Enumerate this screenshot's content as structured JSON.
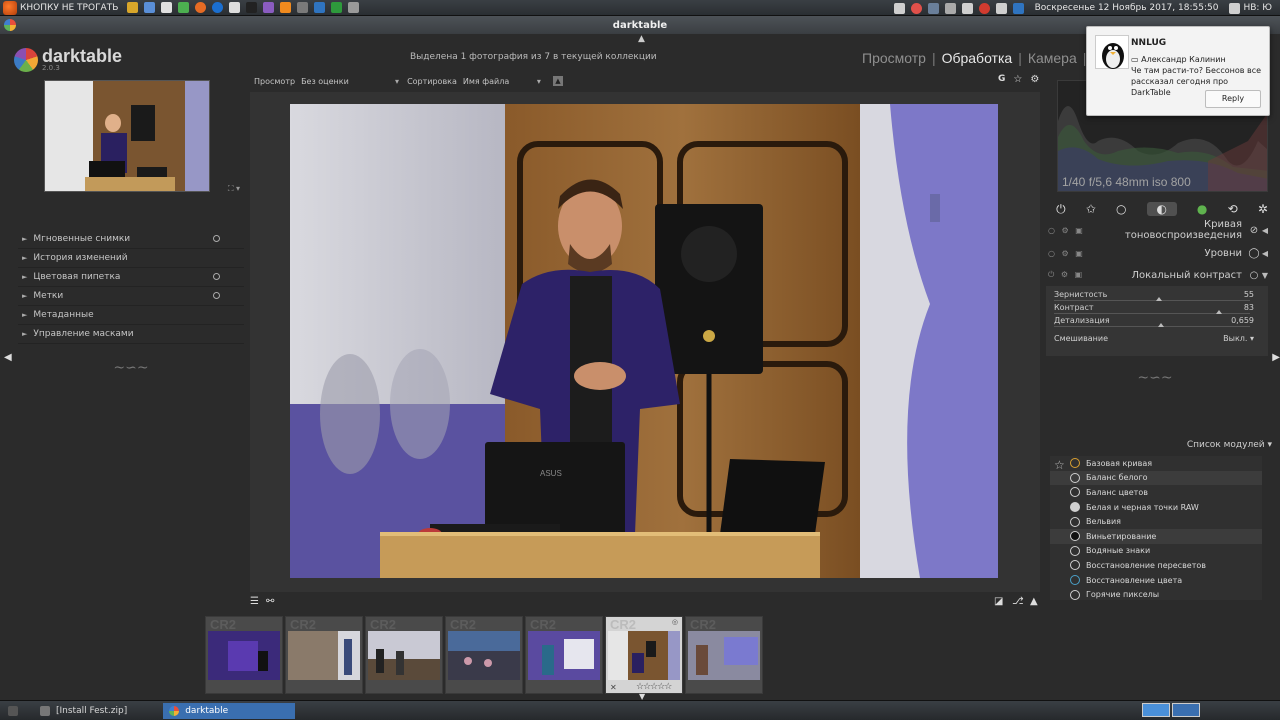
{
  "system_bar": {
    "launcher_label": "КНОПКУ НЕ ТРОГАТЬ",
    "datetime": "Воскресенье 12 Ноябрь 2017, 18:55:50",
    "keyboard_layout": "НВ: Ю"
  },
  "window": {
    "title": "darktable"
  },
  "app": {
    "name": "darktable",
    "version": "2.0.3",
    "selection_status": "Выделена 1 фотография из 7 в текущей коллекции",
    "views": [
      "Просмотр",
      "Обработка",
      "Камера"
    ],
    "active_view": "Обработка"
  },
  "left_panel": {
    "modules": [
      {
        "label": "Мгновенные снимки",
        "has_preset": true
      },
      {
        "label": "История изменений",
        "has_preset": false
      },
      {
        "label": "Цветовая пипетка",
        "has_preset": true
      },
      {
        "label": "Метки",
        "has_preset": true
      },
      {
        "label": "Метаданные",
        "has_preset": false
      },
      {
        "label": "Управление масками",
        "has_preset": false
      }
    ]
  },
  "center_toolbar": {
    "view_label": "Просмотр",
    "view_value": "Без оценки",
    "sort_label": "Сортировка",
    "sort_value": "Имя файла",
    "group_button": "G"
  },
  "right_panel": {
    "exif": "1/40 f/5,6 48mm iso 800",
    "modules": [
      {
        "label": "Кривая тоновоспроизведения",
        "icon": "tonecurve-icon",
        "expanded": false
      },
      {
        "label": "Уровни",
        "icon": "levels-icon",
        "expanded": false
      },
      {
        "label": "Локальный контраст",
        "icon": "local-contrast-icon",
        "expanded": true
      }
    ],
    "local_contrast": {
      "sliders": [
        {
          "label": "Зернистость",
          "value": "55"
        },
        {
          "label": "Контраст",
          "value": "83"
        },
        {
          "label": "Детализация",
          "value": "0,659"
        }
      ],
      "blend_label": "Смешивание",
      "blend_value": "Выкл."
    },
    "module_list_title": "Список модулей",
    "module_list": [
      "Базовая кривая",
      "Баланс белого",
      "Баланс цветов",
      "Белая и черная точки RAW",
      "Вельвия",
      "Виньетирование",
      "Водяные знаки",
      "Восстановление пересветов",
      "Восстановление цвета",
      "Горячие пикселы"
    ]
  },
  "filmstrip": {
    "ext_label": "CR2",
    "thumbs": 7,
    "selected_index": 5,
    "rating_stars": "☆☆☆☆☆"
  },
  "taskbar": {
    "tasks": [
      {
        "label": "[Install Fest.zip]"
      },
      {
        "label": "darktable"
      }
    ]
  },
  "notification": {
    "title": "NNLUG",
    "sender": "Александр Калинин",
    "message": "Че там расти-то? Бессонов все рассказал сегодня про DarkTable",
    "reply_label": "Reply"
  },
  "colors": {
    "accent_blue": "#3a6fb0",
    "panel_bg": "#2b2b2b",
    "photo_bg": "#333333"
  }
}
